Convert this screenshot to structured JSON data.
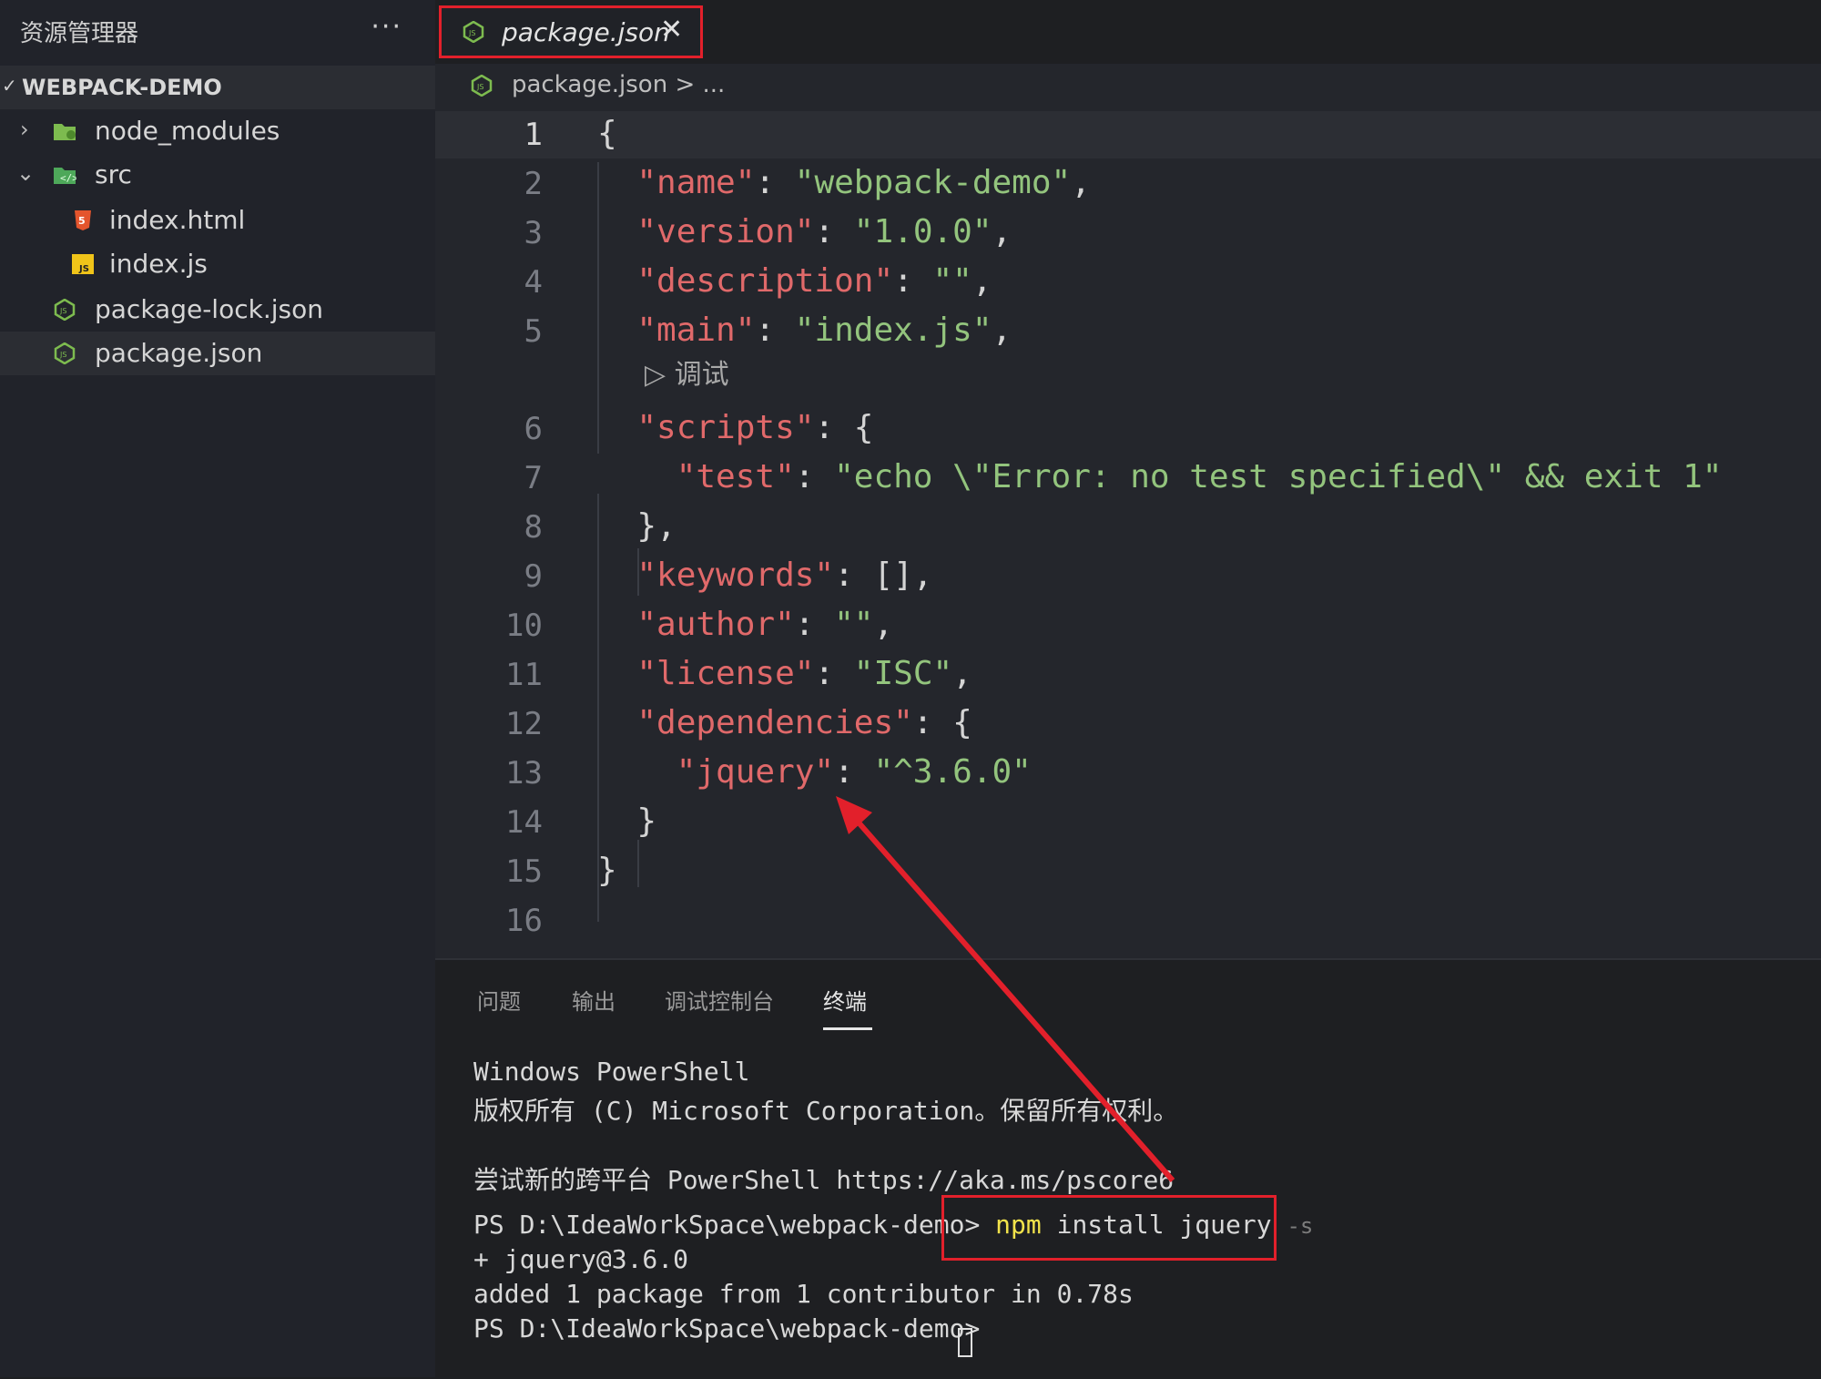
{
  "sidebar": {
    "title": "资源管理器",
    "more": "···",
    "project": "WEBPACK-DEMO",
    "items": [
      {
        "label": "node_modules"
      },
      {
        "label": "src"
      },
      {
        "label": "index.html"
      },
      {
        "label": "index.js"
      },
      {
        "label": "package-lock.json"
      },
      {
        "label": "package.json"
      }
    ]
  },
  "tab": {
    "label": "package.json",
    "close": "✕"
  },
  "breadcrumb": {
    "file": "package.json",
    "rest": " > ..."
  },
  "editor": {
    "line_numbers": [
      "1",
      "2",
      "3",
      "4",
      "5",
      "6",
      "7",
      "8",
      "9",
      "10",
      "11",
      "12",
      "13",
      "14",
      "15",
      "16"
    ],
    "codelens": "▷ 调试",
    "lines": [
      {
        "parts": [
          [
            "p",
            "{"
          ]
        ]
      },
      {
        "parts": [
          [
            "p",
            "  "
          ],
          [
            "k",
            "\"name\""
          ],
          [
            "p",
            ": "
          ],
          [
            "s",
            "\"webpack-demo\""
          ],
          [
            "p",
            ","
          ]
        ]
      },
      {
        "parts": [
          [
            "p",
            "  "
          ],
          [
            "k",
            "\"version\""
          ],
          [
            "p",
            ": "
          ],
          [
            "s",
            "\"1.0.0\""
          ],
          [
            "p",
            ","
          ]
        ]
      },
      {
        "parts": [
          [
            "p",
            "  "
          ],
          [
            "k",
            "\"description\""
          ],
          [
            "p",
            ": "
          ],
          [
            "s",
            "\"\""
          ],
          [
            "p",
            ","
          ]
        ]
      },
      {
        "parts": [
          [
            "p",
            "  "
          ],
          [
            "k",
            "\"main\""
          ],
          [
            "p",
            ": "
          ],
          [
            "s",
            "\"index.js\""
          ],
          [
            "p",
            ","
          ]
        ]
      },
      {
        "parts": [
          [
            "p",
            "  "
          ],
          [
            "k",
            "\"scripts\""
          ],
          [
            "p",
            ": {"
          ]
        ]
      },
      {
        "parts": [
          [
            "p",
            "    "
          ],
          [
            "k",
            "\"test\""
          ],
          [
            "p",
            ": "
          ],
          [
            "s",
            "\"echo \\\"Error: no test specified\\\" && exit 1\""
          ]
        ]
      },
      {
        "parts": [
          [
            "p",
            "  },"
          ]
        ]
      },
      {
        "parts": [
          [
            "p",
            "  "
          ],
          [
            "k",
            "\"keywords\""
          ],
          [
            "p",
            ": [],"
          ]
        ]
      },
      {
        "parts": [
          [
            "p",
            "  "
          ],
          [
            "k",
            "\"author\""
          ],
          [
            "p",
            ": "
          ],
          [
            "s",
            "\"\""
          ],
          [
            "p",
            ","
          ]
        ]
      },
      {
        "parts": [
          [
            "p",
            "  "
          ],
          [
            "k",
            "\"license\""
          ],
          [
            "p",
            ": "
          ],
          [
            "s",
            "\"ISC\""
          ],
          [
            "p",
            ","
          ]
        ]
      },
      {
        "parts": [
          [
            "p",
            "  "
          ],
          [
            "k",
            "\"dependencies\""
          ],
          [
            "p",
            ": {"
          ]
        ]
      },
      {
        "parts": [
          [
            "p",
            "    "
          ],
          [
            "k",
            "\"jquery\""
          ],
          [
            "p",
            ": "
          ],
          [
            "s",
            "\"^3.6.0\""
          ]
        ]
      },
      {
        "parts": [
          [
            "p",
            "  }"
          ]
        ]
      },
      {
        "parts": [
          [
            "p",
            "}"
          ]
        ]
      },
      {
        "parts": [
          [
            "p",
            ""
          ]
        ]
      }
    ]
  },
  "panel": {
    "tabs": [
      "问题",
      "输出",
      "调试控制台",
      "终端"
    ],
    "active_tab": "终端",
    "terminal": {
      "l1": "Windows PowerShell",
      "l2": "版权所有 (C) Microsoft Corporation。保留所有权利。",
      "l3": "尝试新的跨平台 PowerShell https://aka.ms/pscore6",
      "prompt1": "PS D:\\IdeaWorkSpace\\webpack-demo> ",
      "cmd_npm": "npm",
      "cmd_rest": " install jquery ",
      "cmd_flag": "-s",
      "l5": "+ jquery@3.6.0",
      "l6": "added 1 package from 1 contributor in 0.78s",
      "prompt2": "PS D:\\IdeaWorkSpace\\webpack-demo> "
    }
  },
  "colors": {
    "annotation": "#e2202b",
    "json_key": "#e0696a",
    "json_string": "#93c47d"
  }
}
